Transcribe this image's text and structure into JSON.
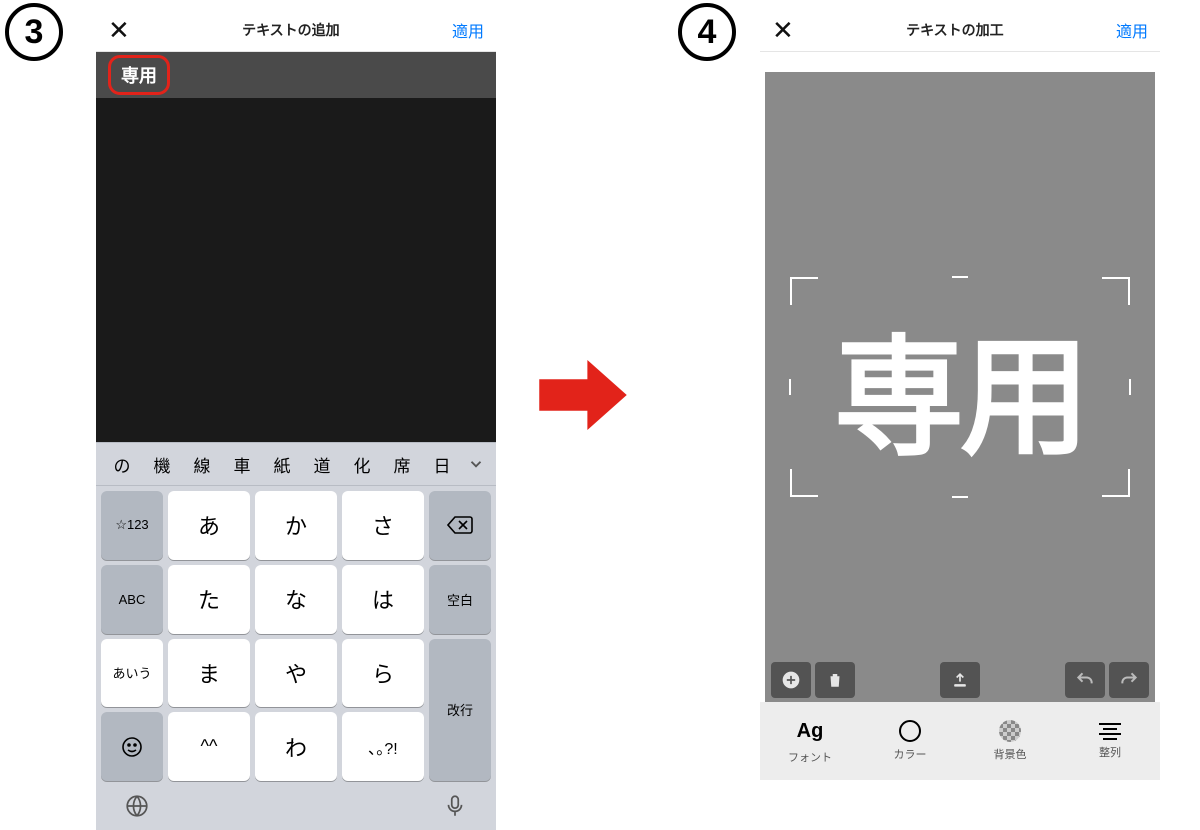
{
  "badges": {
    "step3": "3",
    "step4": "4"
  },
  "left": {
    "title": "テキストの追加",
    "apply": "適用",
    "input_text": "専用",
    "suggestions": [
      "の",
      "機",
      "線",
      "車",
      "紙",
      "道",
      "化",
      "席",
      "日"
    ],
    "keyboard": {
      "func_num": "☆123",
      "func_abc": "ABC",
      "func_kana": "あいう",
      "space": "空白",
      "enter": "改行",
      "rows": [
        [
          "あ",
          "か",
          "さ"
        ],
        [
          "た",
          "な",
          "は"
        ],
        [
          "ま",
          "や",
          "ら"
        ],
        [
          "^^",
          "わ",
          "､｡?!"
        ]
      ]
    }
  },
  "right": {
    "title": "テキストの加工",
    "apply": "適用",
    "canvas_text": "専用",
    "format": {
      "font": "フォント",
      "font_icon": "Ag",
      "color": "カラー",
      "bgcolor": "背景色",
      "align": "整列"
    }
  }
}
